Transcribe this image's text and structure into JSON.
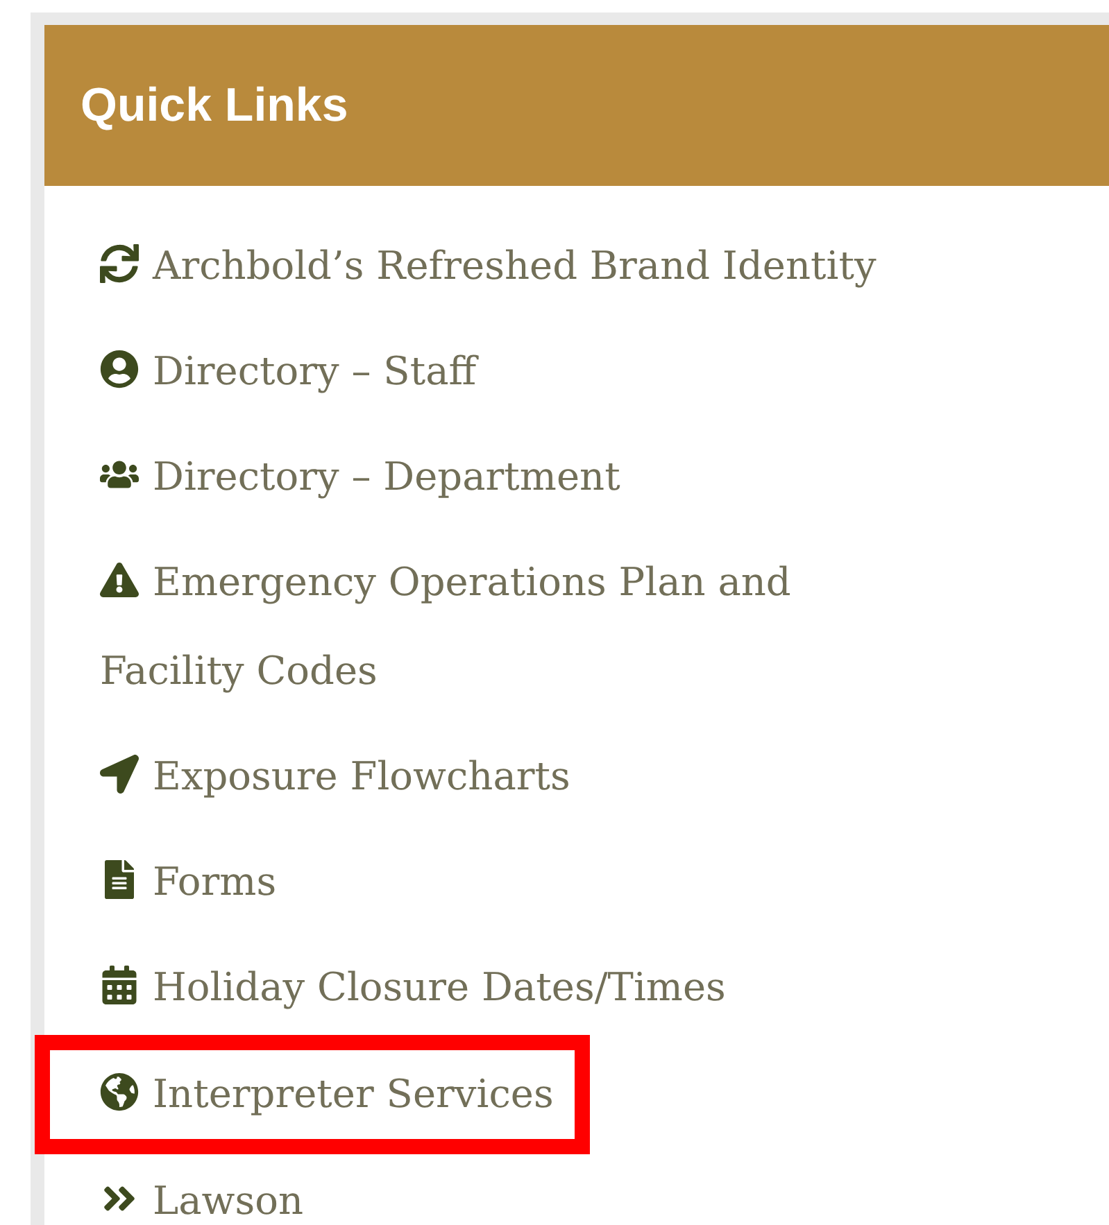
{
  "panel": {
    "title": "Quick Links"
  },
  "items": [
    {
      "kind": "refresh",
      "label": "Archbold’s Refreshed Brand Identity",
      "highlighted": false
    },
    {
      "kind": "user",
      "label": "Directory – Staff",
      "highlighted": false
    },
    {
      "kind": "users",
      "label": "Directory – Department",
      "highlighted": false
    },
    {
      "kind": "warning",
      "label": "Emergency Operations Plan and Facility Codes",
      "highlighted": false
    },
    {
      "kind": "arrow",
      "label": "Exposure Flowcharts",
      "highlighted": false
    },
    {
      "kind": "file",
      "label": "Forms",
      "highlighted": false
    },
    {
      "kind": "calendar",
      "label": "Holiday Closure Dates/Times",
      "highlighted": false
    },
    {
      "kind": "globe",
      "label": "Interpreter Services",
      "highlighted": true
    },
    {
      "kind": "chevrons",
      "label": "Lawson",
      "highlighted": false
    }
  ]
}
